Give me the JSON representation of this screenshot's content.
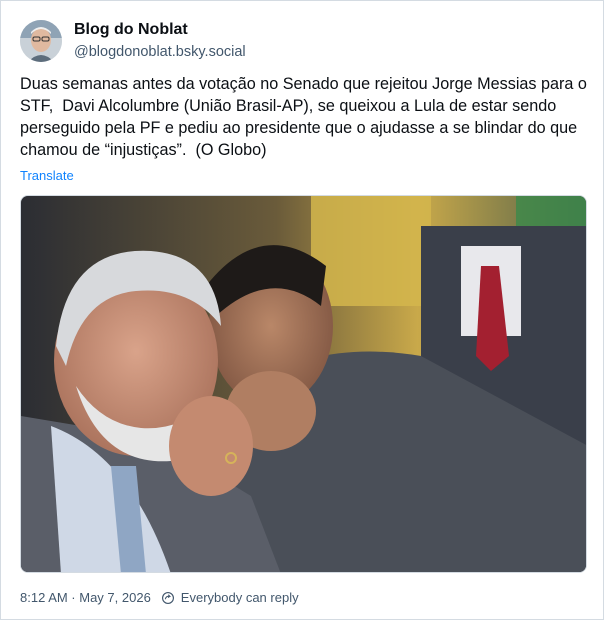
{
  "author": {
    "display_name": "Blog do Noblat",
    "handle": "@blogdonoblat.bsky.social"
  },
  "post": {
    "text": "Duas semanas antes da votação no Senado que rejeitou Jorge Messias para o STF,  Davi Alcolumbre (União Brasil-AP), se queixou a Lula de estar sendo perseguido pela PF e pediu ao presidente que o ajudasse a se blindar do que chamou de “injustiças”.  (O Globo)",
    "translate_label": "Translate"
  },
  "meta": {
    "timestamp": "8:12 AM · May 7, 2026",
    "reply_setting": "Everybody can reply"
  },
  "colors": {
    "link": "#1083fe",
    "muted_text": "#42576c",
    "border": "#d4dbe2"
  },
  "icons": {
    "avatar": "avatar-photo",
    "reply_setting": "globe-reply-icon"
  }
}
